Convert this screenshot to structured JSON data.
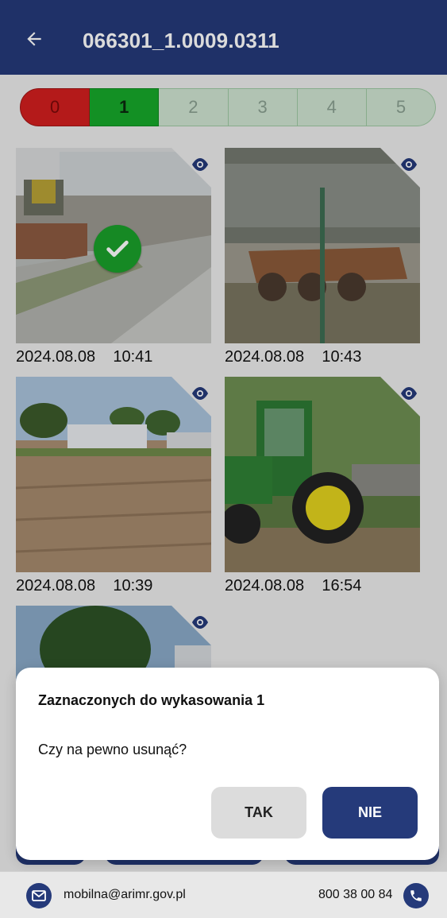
{
  "header": {
    "title": "066301_1.0009.0311"
  },
  "segments": [
    {
      "label": "0",
      "state": "red"
    },
    {
      "label": "1",
      "state": "selected"
    },
    {
      "label": "2",
      "state": "inactive"
    },
    {
      "label": "3",
      "state": "inactive"
    },
    {
      "label": "4",
      "state": "inactive"
    },
    {
      "label": "5",
      "state": "inactive"
    }
  ],
  "photos": [
    {
      "date": "2024.08.08",
      "time": "10:41",
      "marked": true
    },
    {
      "date": "2024.08.08",
      "time": "10:43",
      "marked": false
    },
    {
      "date": "2024.08.08",
      "time": "10:39",
      "marked": false
    },
    {
      "date": "2024.08.08",
      "time": "16:54",
      "marked": false
    },
    {
      "date": "",
      "time": "",
      "marked": false
    }
  ],
  "dialog": {
    "title": "Zaznaczonych do wykasowania 1",
    "message": "Czy na pewno usunąć?",
    "confirm_label": "TAK",
    "cancel_label": "NIE"
  },
  "footer": {
    "email": "mobilna@arimr.gov.pl",
    "phone": "800 38 00 84"
  },
  "colors": {
    "primary": "#253a7a",
    "segment_red": "#d21f1f",
    "segment_green": "#17a82a",
    "segment_light": "#cfe3d1",
    "check": "#1aa02a"
  }
}
